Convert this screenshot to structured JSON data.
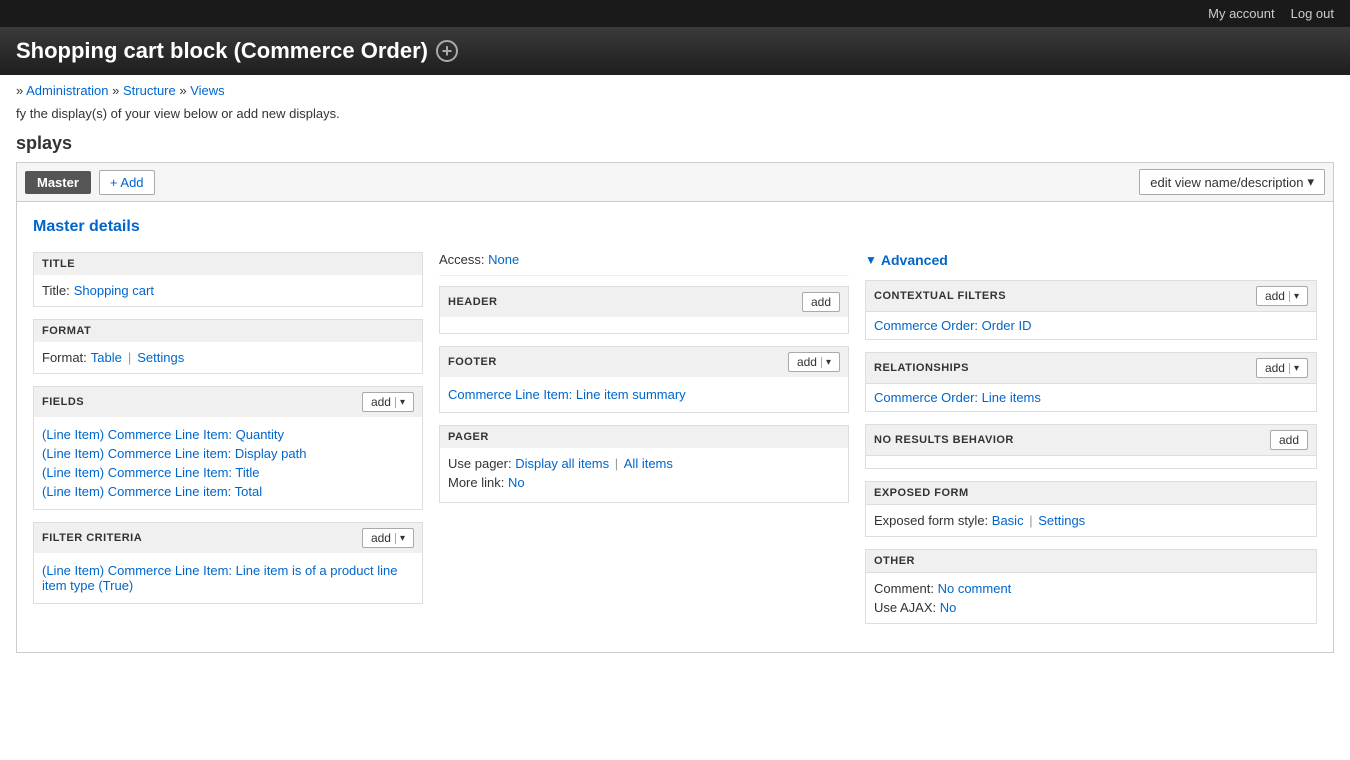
{
  "topbar": {
    "my_account": "My account",
    "log_out": "Log out"
  },
  "page_title": "Shopping cart block (Commerce Order)",
  "add_icon_label": "+",
  "breadcrumb": {
    "prefix": "»",
    "administration": "Administration",
    "structure": "Structure",
    "views": "Views",
    "separator": "»"
  },
  "page_description": "fy the display(s) of your view below or add new displays.",
  "displays": {
    "heading": "splays",
    "master_tab": "Master",
    "add_button": "+ Add",
    "edit_view_button": "edit view name/description"
  },
  "master_details": {
    "heading": "Master details"
  },
  "left_col": {
    "title_section": {
      "label": "TITLE",
      "title_label": "Title:",
      "title_value": "Shopping cart"
    },
    "format_section": {
      "label": "FORMAT",
      "format_label": "Format:",
      "format_value": "Table",
      "pipe": "|",
      "settings_label": "Settings"
    },
    "fields_section": {
      "label": "FIELDS",
      "add_button": "add",
      "fields": [
        "(Line Item) Commerce Line Item: Quantity",
        "(Line Item) Commerce Line item: Display path",
        "(Line Item) Commerce Line Item: Title",
        "(Line Item) Commerce Line item: Total"
      ]
    },
    "filter_criteria_section": {
      "label": "FILTER CRITERIA",
      "add_button": "add",
      "filters": [
        "(Line Item) Commerce Line Item: Line item is of a product line item type (True)"
      ]
    }
  },
  "mid_col": {
    "access": {
      "label": "Access:",
      "value": "None"
    },
    "header_section": {
      "label": "HEADER",
      "add_button": "add"
    },
    "footer_section": {
      "label": "FOOTER",
      "add_button": "add",
      "item": "Commerce Line Item: Line item summary"
    },
    "pager_section": {
      "label": "PAGER",
      "use_pager_label": "Use pager:",
      "display_all": "Display all items",
      "pipe": "|",
      "all_items": "All items",
      "more_link_label": "More link:",
      "more_link_value": "No"
    }
  },
  "right_col": {
    "advanced_heading": "Advanced",
    "contextual_filters": {
      "label": "CONTEXTUAL FILTERS",
      "add_button": "add",
      "item": "Commerce Order: Order ID"
    },
    "relationships": {
      "label": "RELATIONSHIPS",
      "add_button": "add",
      "item": "Commerce Order: Line items"
    },
    "no_results": {
      "label": "NO RESULTS BEHAVIOR",
      "add_button": "add"
    },
    "exposed_form": {
      "label": "EXPOSED FORM",
      "style_label": "Exposed form style:",
      "style_value": "Basic",
      "pipe": "|",
      "settings_label": "Settings"
    },
    "other": {
      "label": "OTHER",
      "comment_label": "Comment:",
      "comment_value": "No comment",
      "ajax_label": "Use AJAX:",
      "ajax_value": "No"
    }
  }
}
